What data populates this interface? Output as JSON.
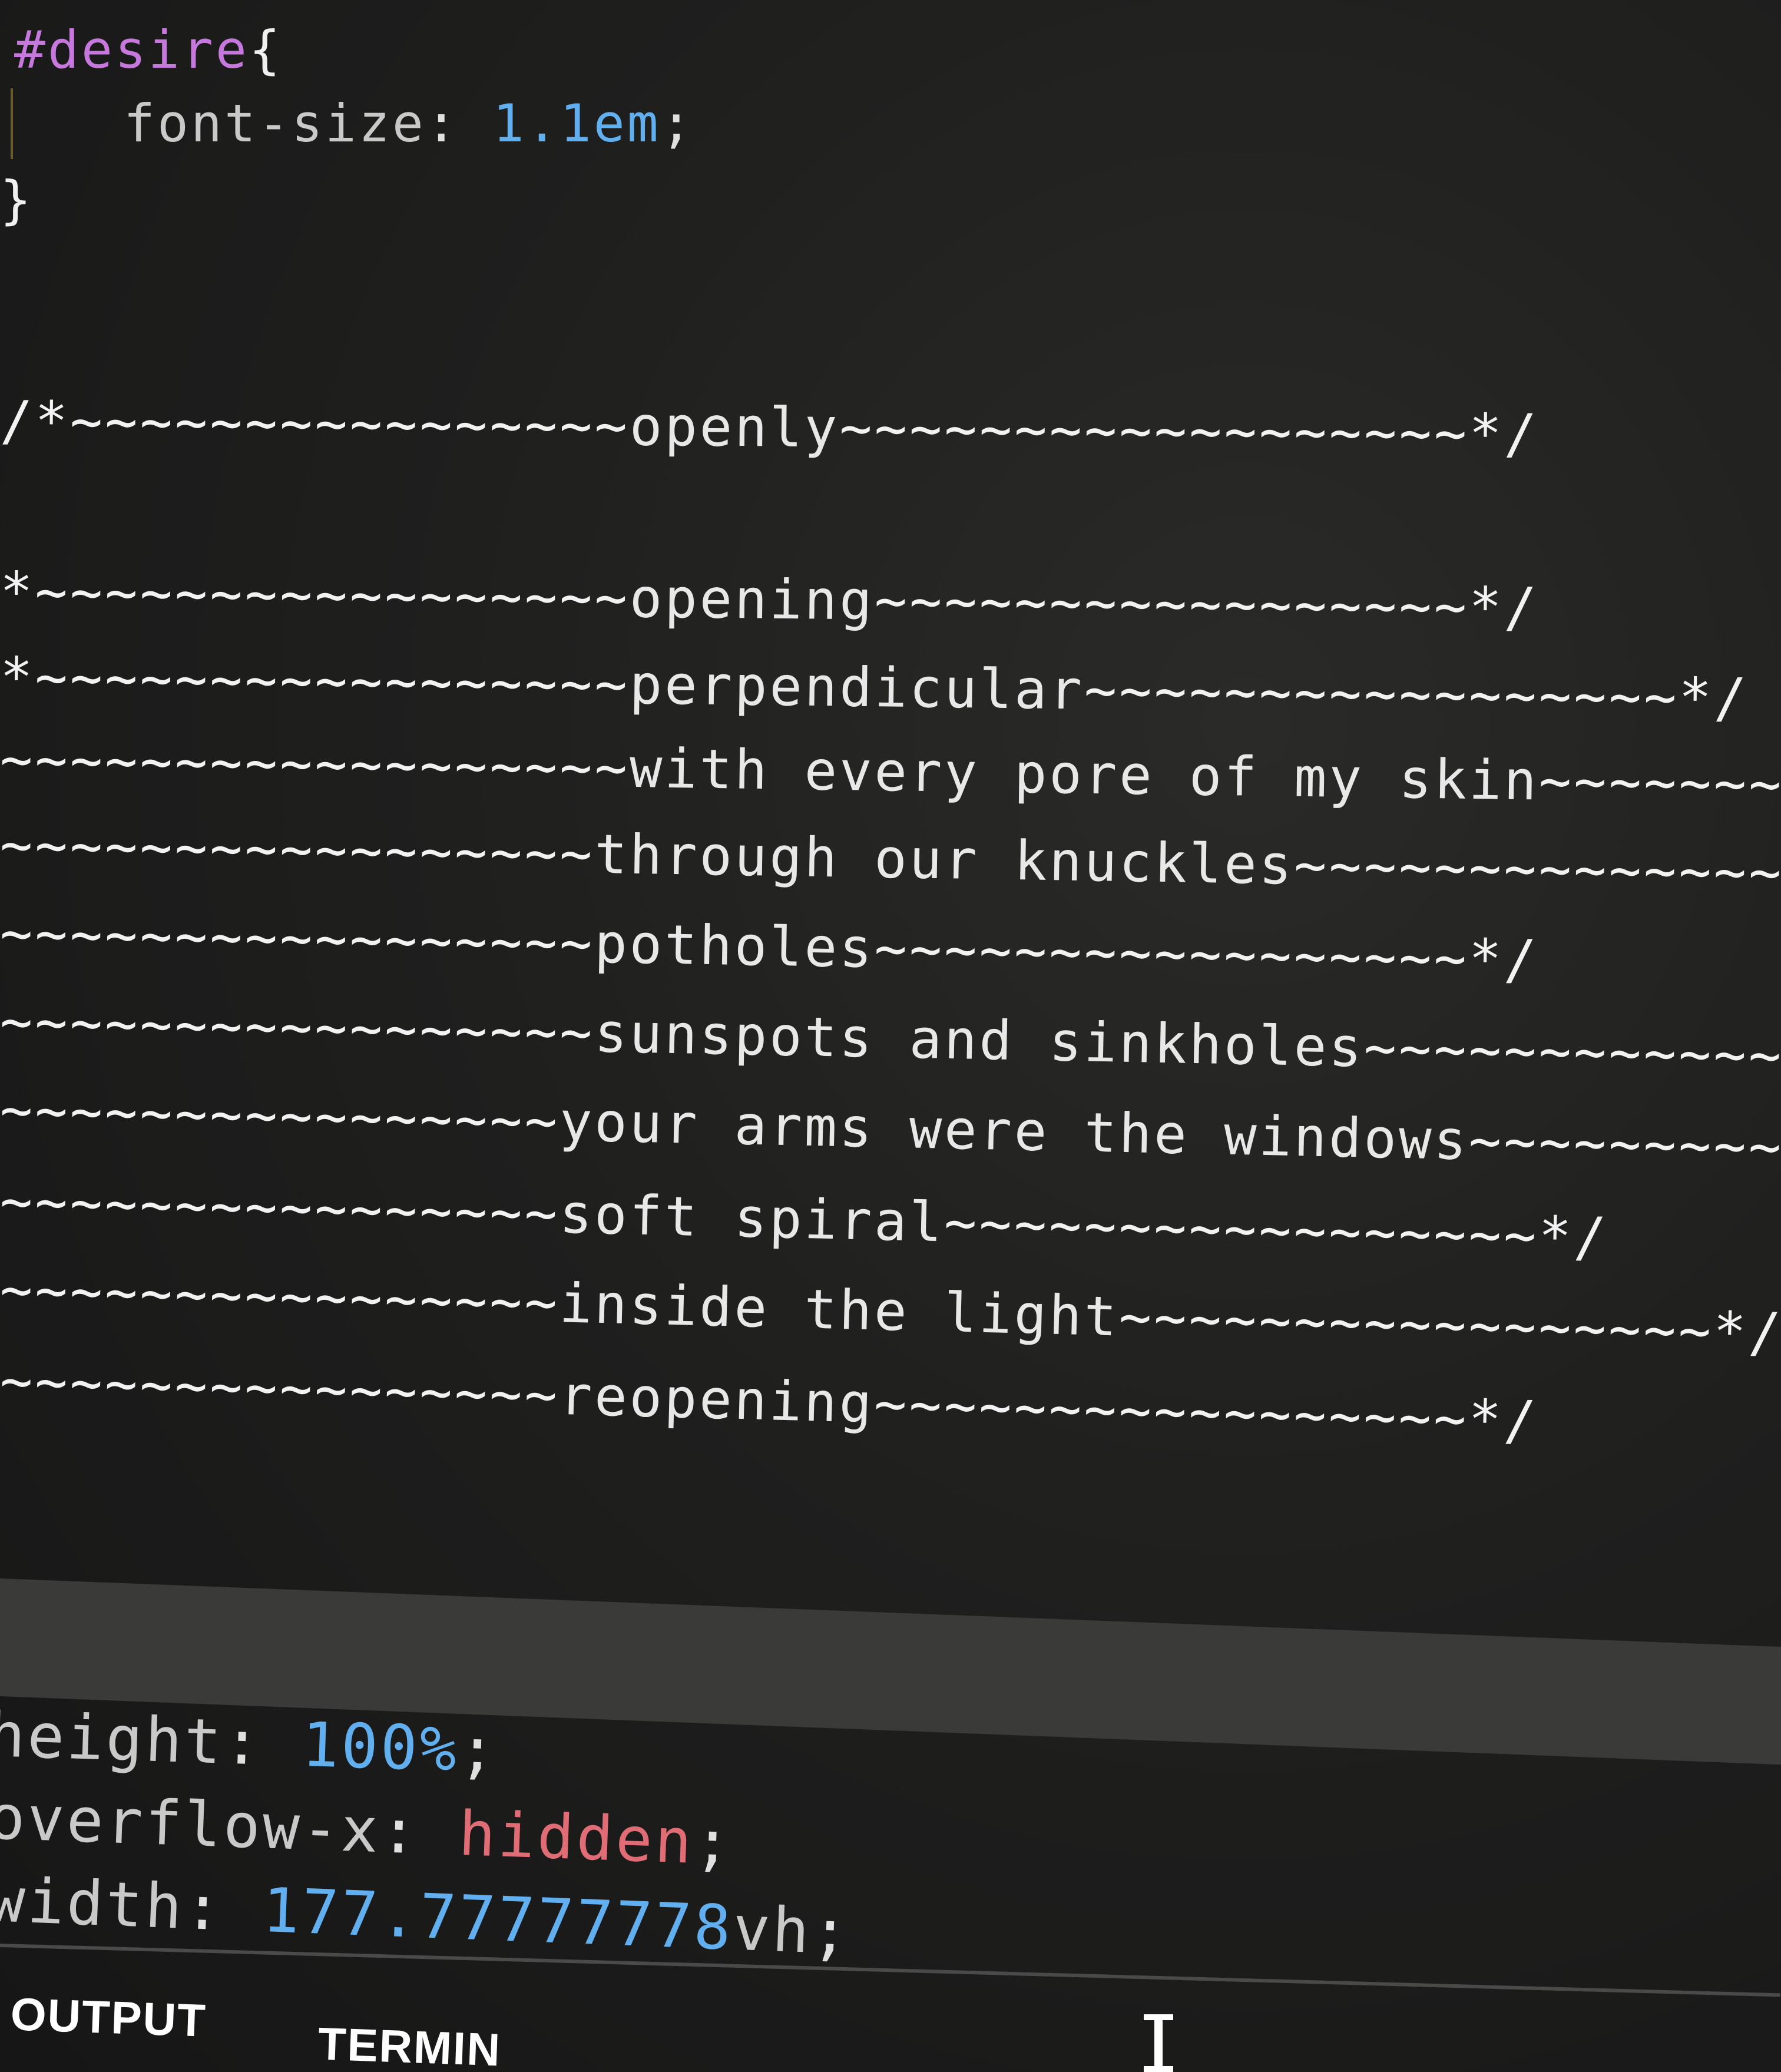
{
  "css_block": {
    "selector": "#desire",
    "open_brace": "{",
    "property": "font-size",
    "colon": ":",
    "value": "1.1em",
    "semicolon": ";",
    "close_brace": "}"
  },
  "poem_lines": [
    {
      "prefix": "/*~~~~~~~~~~~~~~~~",
      "text": "openly",
      "suffix": "~~~~~~~~~~~~~~~~~~*/"
    },
    {
      "prefix": "*~~~~~~~~~~~~~~~~~",
      "text": "opening",
      "suffix": "~~~~~~~~~~~~~~~~~*/"
    },
    {
      "prefix": "*~~~~~~~~~~~~~~~~~",
      "text": "perpendicular",
      "suffix": "~~~~~~~~~~~~~~~~~*/"
    },
    {
      "prefix": "~~~~~~~~~~~~~~~~~~",
      "text": "with every pore of my skin",
      "suffix": "~~~~~~~~~~~"
    },
    {
      "prefix": "~~~~~~~~~~~~~~~~~",
      "text": "through our knuckles",
      "suffix": "~~~~~~~~~~~~~~~~~~"
    },
    {
      "prefix": "~~~~~~~~~~~~~~~~~",
      "text": "potholes",
      "suffix": "~~~~~~~~~~~~~~~~~*/"
    },
    {
      "prefix": "~~~~~~~~~~~~~~~~~",
      "text": "sunspots and sinkholes",
      "suffix": "~~~~~~~~~~~~~~~~"
    },
    {
      "prefix": "~~~~~~~~~~~~~~~~",
      "text": "your arms were the windows",
      "suffix": "~~~~~~~~~~~~"
    },
    {
      "prefix": "~~~~~~~~~~~~~~~~",
      "text": "soft spiral",
      "suffix": "~~~~~~~~~~~~~~~~~*/"
    },
    {
      "prefix": "~~~~~~~~~~~~~~~~",
      "text": "inside the light",
      "suffix": "~~~~~~~~~~~~~~~~~*/"
    },
    {
      "prefix": "~~~~~~~~~~~~~~~~",
      "text": "reopening",
      "suffix": "~~~~~~~~~~~~~~~~~*/"
    }
  ],
  "lower_editor": {
    "line1": {
      "property": "height",
      "colon": ":",
      "value": "100%",
      "semicolon": ";"
    },
    "line2": {
      "property": "overflow-x",
      "colon": ":",
      "value": "hidden",
      "semicolon": ";"
    },
    "line3": {
      "property": "width",
      "colon": ":",
      "value_num": "177.77777778",
      "unit": "vh",
      "semicolon": ";"
    }
  },
  "panel": {
    "tabs": [
      "OUTPUT",
      "TERMIN"
    ]
  },
  "colors": {
    "selector": "#c678dd",
    "number": "#61afef",
    "keyword_value": "#e06c75",
    "text": "#e8e8e8",
    "background": "#1c1c1c"
  }
}
